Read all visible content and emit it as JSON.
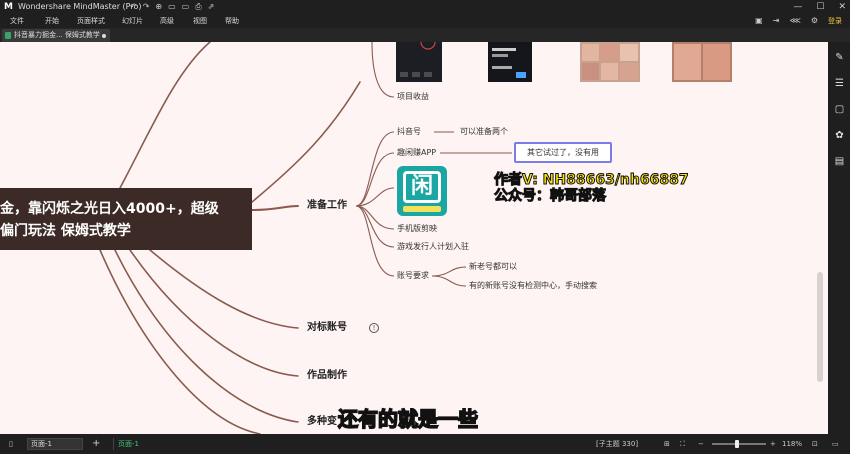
{
  "window": {
    "title": "Wondershare MindMaster (Pro)",
    "logo": "M",
    "toolbar_icons": [
      "undo-icon",
      "redo-icon",
      "new-icon",
      "open-icon",
      "save-icon",
      "print-icon",
      "export-icon"
    ],
    "toolbar_glyphs": [
      "↶",
      "↷",
      "⊕",
      "▭",
      "▭",
      "⎙",
      "⇗"
    ],
    "controls": {
      "minimize": "—",
      "maximize": "☐",
      "close": "✕"
    }
  },
  "menu": {
    "items": [
      "文件",
      "开始",
      "页面样式",
      "幻灯片",
      "高级",
      "视图",
      "帮助"
    ],
    "right_icons": [
      "▣",
      "⇥",
      "⋘",
      "⚙"
    ],
    "login_label": "登录"
  },
  "tab": {
    "label": "抖音暴力掘金... 保姆式教学"
  },
  "central_topic": {
    "line1": "金，靠闪烁之光日入4000+，超级",
    "line2": "偏门玩法  保姆式教学"
  },
  "branches": {
    "project_income": "项目收益",
    "prep_work": "准备工作",
    "douyin_account": "抖音号",
    "prepare_two": "可以准备两个",
    "quxianzhuan": "趣闲赚APP",
    "callout": "其它试过了，没有用",
    "app_icon_glyph": "闲",
    "mobile_jianying": "手机版剪映",
    "game_publisher": "游戏发行人计划入驻",
    "account_req": "账号要求",
    "new_old_ok": "新老号都可以",
    "some_new": "有的新账号没有检测中心，手动搜索",
    "benchmark": "对标账号",
    "benchmark_info": "!",
    "production": "作品制作",
    "multi": "多种变"
  },
  "overlay": {
    "watermark_line1": "作者V: NH88663/nh66887",
    "watermark_line2": "公众号：韩哥部落",
    "subtitle": "还有的就是一些"
  },
  "rightbar_icons": [
    "paint-icon",
    "layout-icon",
    "outline-icon",
    "attach-icon",
    "task-icon"
  ],
  "rightbar_glyphs": [
    "✎",
    "☰",
    "▢",
    "✿",
    "▤"
  ],
  "status": {
    "page_select": "页面-1",
    "add": "+",
    "page_tab": "页面-1",
    "subtopic_count": "[子主题 330]",
    "zoom": "118%",
    "zoom_level": 0.45
  },
  "colors": {
    "canvas": "#fdf4f3",
    "branch": "#8a5a4f",
    "central_bg": "#3c2a26",
    "callout_border": "#7b7de6",
    "accent_green": "#46c37b",
    "watermark": "#ffe400"
  }
}
